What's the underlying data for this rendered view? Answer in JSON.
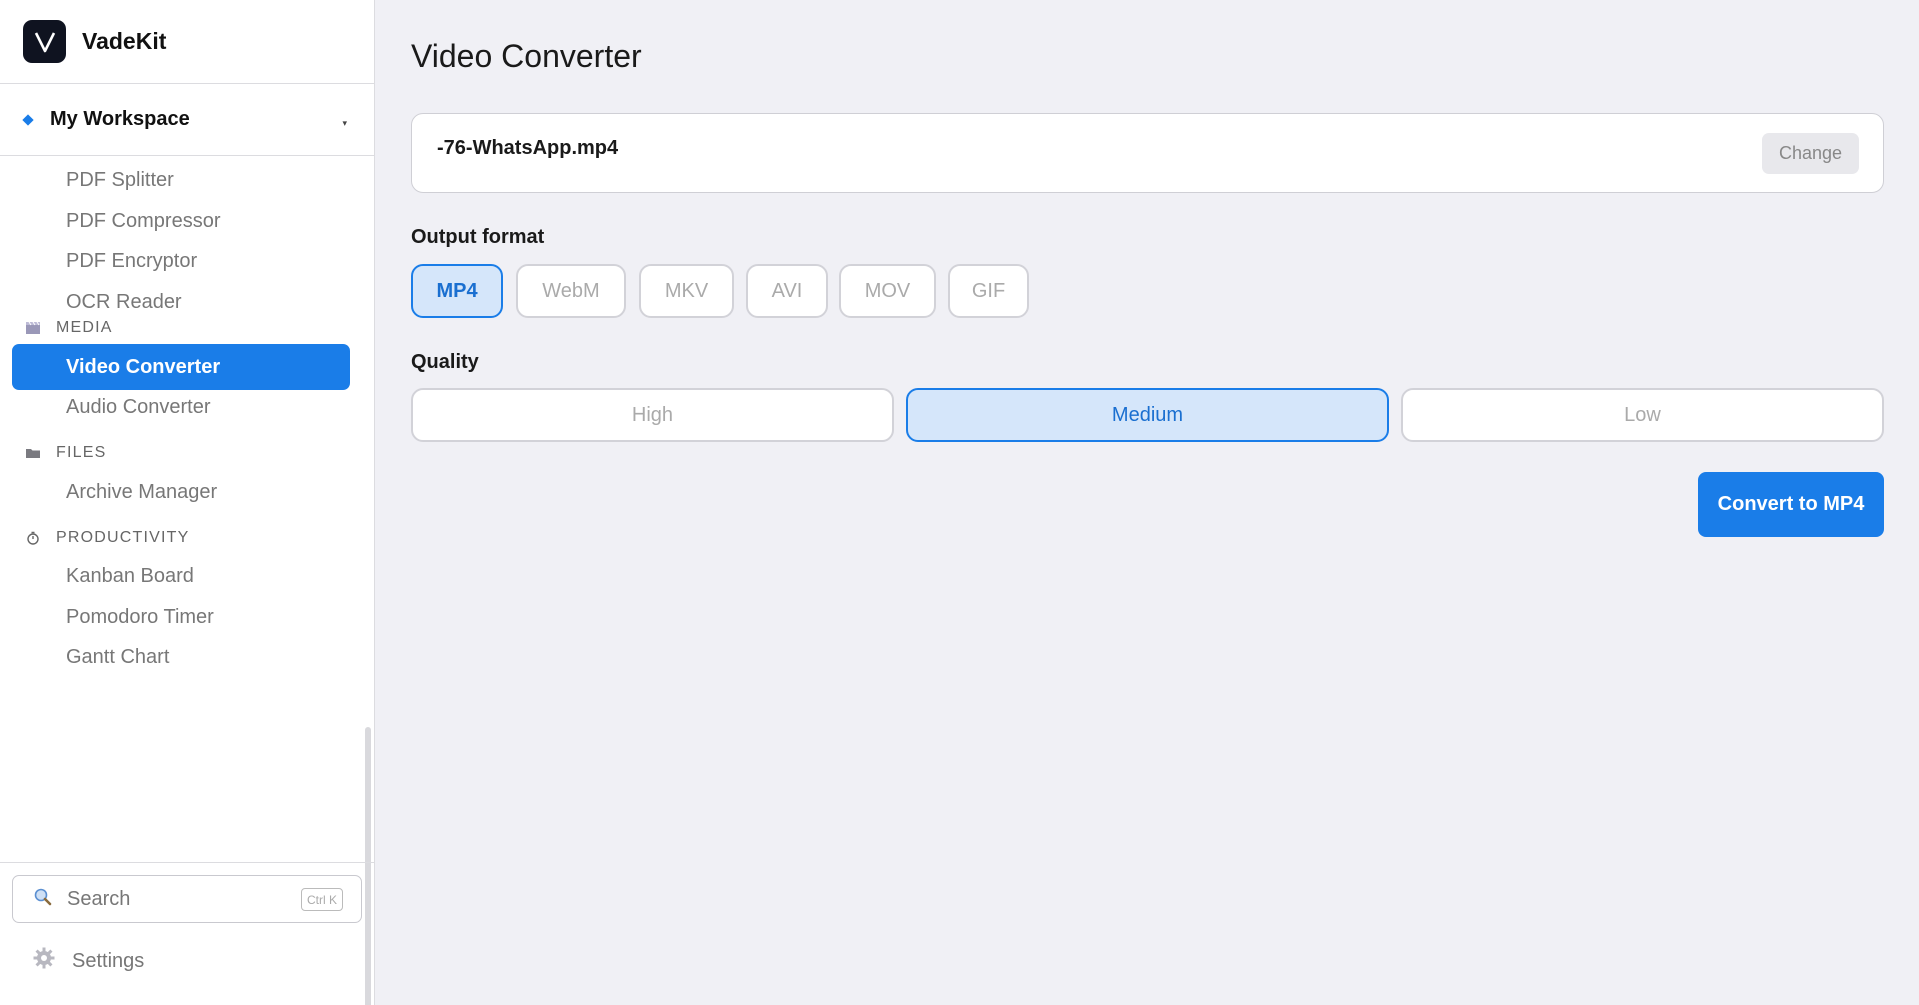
{
  "brand": {
    "name": "VadeKit",
    "logo_letter": "V"
  },
  "workspace": {
    "label": "My Workspace",
    "caret": "▾"
  },
  "nav": {
    "pdf_items": [
      "PDF Splitter",
      "PDF Compressor",
      "PDF Encryptor",
      "OCR Reader"
    ],
    "sections": {
      "media": "MEDIA",
      "files": "FILES",
      "productivity": "PRODUCTIVITY"
    },
    "media_items": [
      "Video Converter",
      "Audio Converter"
    ],
    "files_items": [
      "Archive Manager"
    ],
    "productivity_items": [
      "Kanban Board",
      "Pomodoro Timer",
      "Gantt Chart"
    ],
    "active_item": "Video Converter"
  },
  "search": {
    "placeholder": "Search",
    "shortcut": "Ctrl K"
  },
  "settings": {
    "label": "Settings"
  },
  "main": {
    "title": "Video Converter",
    "file_name": "-76-WhatsApp.mp4",
    "change_label": "Change",
    "output_format_label": "Output format",
    "formats": [
      "MP4",
      "WebM",
      "MKV",
      "AVI",
      "MOV",
      "GIF"
    ],
    "selected_format": "MP4",
    "quality_label": "Quality",
    "qualities": [
      "High",
      "Medium",
      "Low"
    ],
    "selected_quality": "Medium",
    "convert_label": "Convert to MP4"
  },
  "colors": {
    "accent": "#1a7de8",
    "selected_bg": "#d5e6fa"
  }
}
